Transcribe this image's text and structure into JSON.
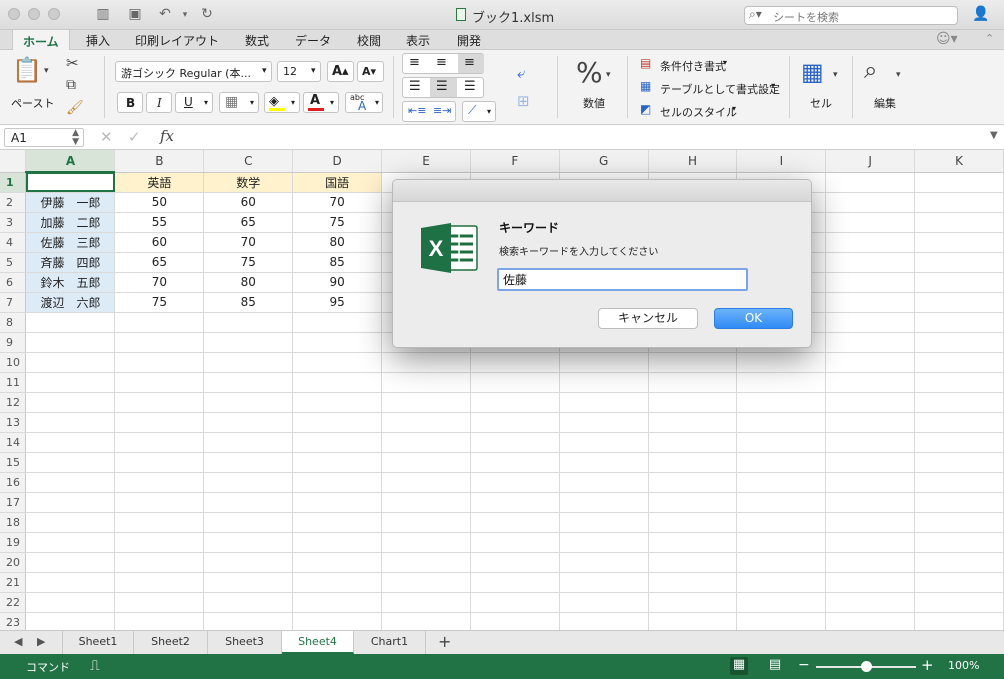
{
  "window": {
    "title": "ブック1.xlsm",
    "search_placeholder": "シートを検索"
  },
  "ribbon_tabs": [
    "ホーム",
    "挿入",
    "印刷レイアウト",
    "数式",
    "データ",
    "校閲",
    "表示",
    "開発"
  ],
  "ribbon": {
    "paste_label": "ペースト",
    "font_name": "游ゴシック Regular (本...",
    "font_size": "12",
    "number_label": "数値",
    "cond_format": "条件付き書式",
    "table_format": "テーブルとして書式設定",
    "cell_style": "セルのスタイル",
    "cells_label": "セル",
    "edit_label": "編集",
    "bold": "B",
    "italic": "I",
    "underline": "U"
  },
  "formula_bar": {
    "name_box": "A1",
    "fx": "fx",
    "formula": ""
  },
  "grid": {
    "columns": [
      "A",
      "B",
      "C",
      "D",
      "E",
      "F",
      "G",
      "H",
      "I",
      "J",
      "K"
    ],
    "selected_column": "A",
    "selected_row": 1,
    "row_count": 23,
    "header_row": [
      "",
      "英語",
      "数学",
      "国語"
    ],
    "rows": [
      [
        "伊藤　一郎",
        "50",
        "60",
        "70"
      ],
      [
        "加藤　二郎",
        "55",
        "65",
        "75"
      ],
      [
        "佐藤　三郎",
        "60",
        "70",
        "80"
      ],
      [
        "斉藤　四郎",
        "65",
        "75",
        "85"
      ],
      [
        "鈴木　五郎",
        "70",
        "80",
        "90"
      ],
      [
        "渡辺　六郎",
        "75",
        "85",
        "95"
      ]
    ]
  },
  "dialog": {
    "title": "キーワード",
    "message": "検索キーワードを入力してください",
    "input_value": "佐藤",
    "cancel_label": "キャンセル",
    "ok_label": "OK"
  },
  "sheets": [
    "Sheet1",
    "Sheet2",
    "Sheet3",
    "Sheet4",
    "Chart1"
  ],
  "active_sheet": "Sheet4",
  "status": {
    "mode": "コマンド",
    "zoom": "100%",
    "zoom_fraction": 0.5
  },
  "colors": {
    "excel_green": "#217346",
    "header_fill": "#fff2cc",
    "name_fill": "#ddebf7",
    "ok_blue": "#2f8bf6"
  }
}
